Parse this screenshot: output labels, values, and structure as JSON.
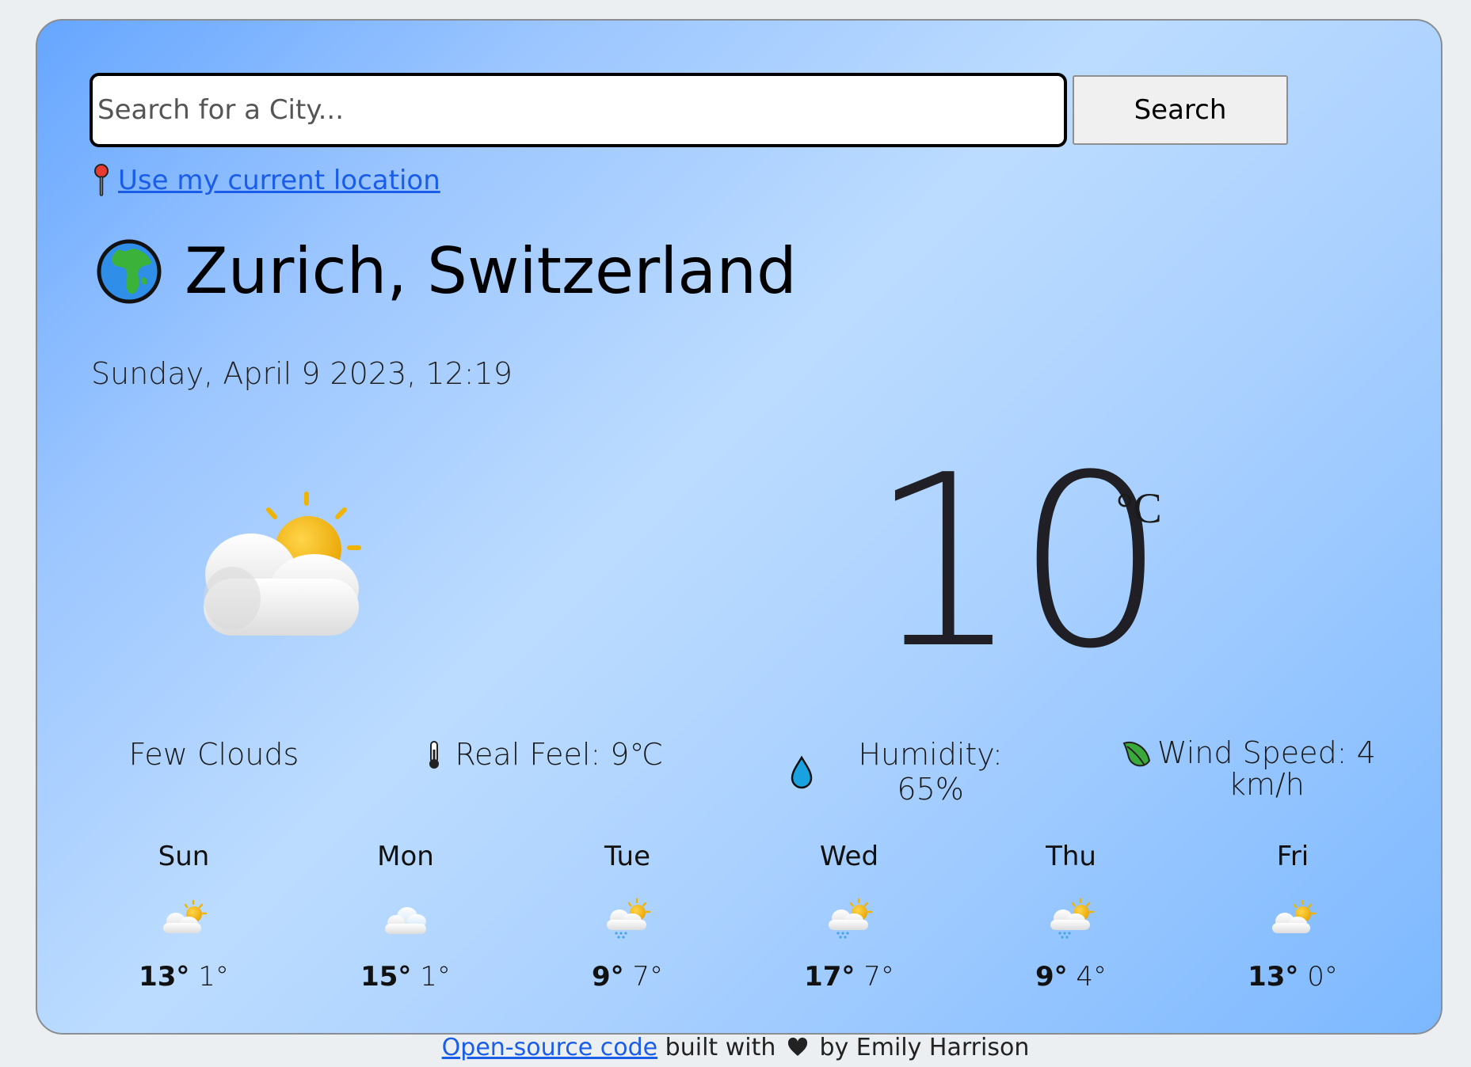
{
  "search": {
    "placeholder": "Search for a City...",
    "button_label": "Search"
  },
  "location": {
    "icon": "pin-icon",
    "link_label": "Use my current location"
  },
  "current": {
    "city_icon": "globe-icon",
    "city": "Zurich, Switzerland",
    "datetime": "Sunday, April 9 2023, 12:19",
    "weather_icon": "partly-cloudy-icon",
    "temperature": "10",
    "unit": "°C",
    "description": "Few Clouds",
    "real_feel": "Real Feel: 9℃",
    "humidity": "Humidity: 65%",
    "wind_speed_line1": "Wind Speed: 4",
    "wind_speed_line2": "km/h"
  },
  "forecast": [
    {
      "day": "Sun",
      "icon": "partly-cloudy-icon",
      "high": "13°",
      "low": "1°"
    },
    {
      "day": "Mon",
      "icon": "cloudy-icon",
      "high": "15°",
      "low": "1°"
    },
    {
      "day": "Tue",
      "icon": "sun-rain-cloud-icon",
      "high": "9°",
      "low": "7°"
    },
    {
      "day": "Wed",
      "icon": "sun-rain-cloud-icon",
      "high": "17°",
      "low": "7°"
    },
    {
      "day": "Thu",
      "icon": "sun-rain-cloud-icon",
      "high": "9°",
      "low": "4°"
    },
    {
      "day": "Fri",
      "icon": "partly-cloudy-icon",
      "high": "13°",
      "low": "0°"
    }
  ],
  "footer": {
    "link_label": "Open-source code",
    "text_built": "built with",
    "text_by": "by Emily Harrison"
  },
  "colors": {
    "gradient_start": "#66a6ff",
    "gradient_mid": "#bcdcff",
    "gradient_end": "#7cb8ff",
    "link": "#1a5de8"
  }
}
